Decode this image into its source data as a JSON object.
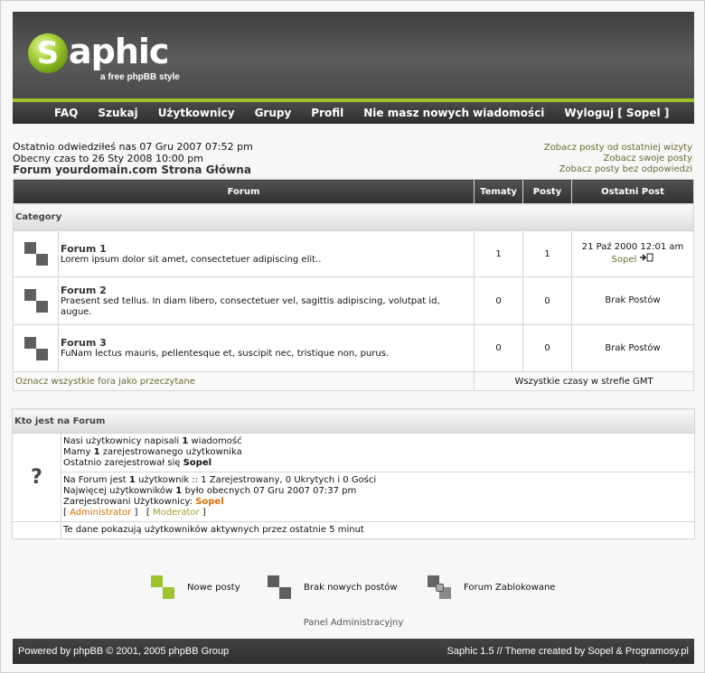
{
  "header": {
    "logo_letter": "S",
    "logo_text": "aphic",
    "tagline": "a free phpBB style",
    "colors": {
      "accent": "#9cc42a",
      "header_bg": "#4a4a4a",
      "nav_bg": "#3a3a3a"
    }
  },
  "nav": {
    "items": [
      {
        "label": "FAQ"
      },
      {
        "label": "Szukaj"
      },
      {
        "label": "Użytkownicy"
      },
      {
        "label": "Grupy"
      },
      {
        "label": "Profil"
      },
      {
        "label": "Nie masz nowych wiadomości"
      },
      {
        "label": "Wyloguj [ Sopel ]"
      }
    ]
  },
  "info": {
    "last_visit": "Ostatnio odwiedziłeś nas 07 Gru 2007 07:52 pm",
    "current_time": "Obecny czas to 26 Sty 2008 10:00 pm",
    "home_link": "Forum yourdomain.com Strona Główna",
    "links": [
      "Zobacz posty od ostatniej wizyty",
      "Zobacz swoje posty",
      "Zobacz posty bez odpowiedzi"
    ]
  },
  "forum_table": {
    "headers": {
      "forum": "Forum",
      "topics": "Tematy",
      "posts": "Posty",
      "last_post": "Ostatni Post"
    },
    "category": "Category",
    "forums": [
      {
        "name": "Forum 1",
        "description": "Lorem ipsum dolor sit amet, consectetuer adipiscing elit..",
        "topics": "1",
        "posts": "1",
        "last_post_date": "21 Paź 2000 12:01 am",
        "last_post_author": "Sopel",
        "last_post_icon": "go-to-post-icon"
      },
      {
        "name": "Forum 2",
        "description": "Praesent sed tellus. In diam libero, consectetuer vel, sagittis adipiscing, volutpat id, augue.",
        "topics": "0",
        "posts": "0",
        "last_post_date": "Brak Postów",
        "last_post_author": "",
        "last_post_icon": ""
      },
      {
        "name": "Forum 3",
        "description": "FuNam lectus mauris, pellentesque et, suscipit nec, tristique non, purus.",
        "topics": "0",
        "posts": "0",
        "last_post_date": "Brak Postów",
        "last_post_author": "",
        "last_post_icon": ""
      }
    ],
    "mark_read": "Oznacz wszystkie fora jako przeczytane",
    "timezone": "Wszystkie czasy w strefie GMT"
  },
  "who": {
    "title": "Kto jest na Forum",
    "icon": "question-mark-icon",
    "stats": {
      "posts_pre": "Nasi użytkownicy napisali ",
      "posts_count": "1",
      "posts_post": " wiadomość",
      "users_pre": "Mamy ",
      "users_count": "1",
      "users_post": " zarejestrowanego użytkownika",
      "newest_pre": "Ostatnio zarejestrował się ",
      "newest_user": "Sopel"
    },
    "online": {
      "now_pre": "Na Forum jest ",
      "now_count": "1",
      "now_post": " użytkownik :: 1 Zarejestrowany, 0 Ukrytych i 0 Gości",
      "record_pre": "Najwięcej użytkowników ",
      "record_count": "1",
      "record_post": " było obecnych 07 Gru 2007 07:37 pm",
      "registered_label": "Zarejestrowani Użytkownicy: ",
      "registered_user": "Sopel",
      "admin_label": "Administrator",
      "moderator_label": "Moderator"
    },
    "footer_note": "Te dane pokazują użytkowników aktywnych przez ostatnie 5 minut"
  },
  "legend": {
    "new_posts": "Nowe posty",
    "no_new_posts": "Brak nowych postów",
    "locked": "Forum Zablokowane"
  },
  "admin_panel": "Panel Administracyjny",
  "footer": {
    "left": "Powered by phpBB © 2001, 2005 phpBB Group",
    "right": "Saphic 1.5 // Theme created by Sopel & Programosy.pl"
  }
}
